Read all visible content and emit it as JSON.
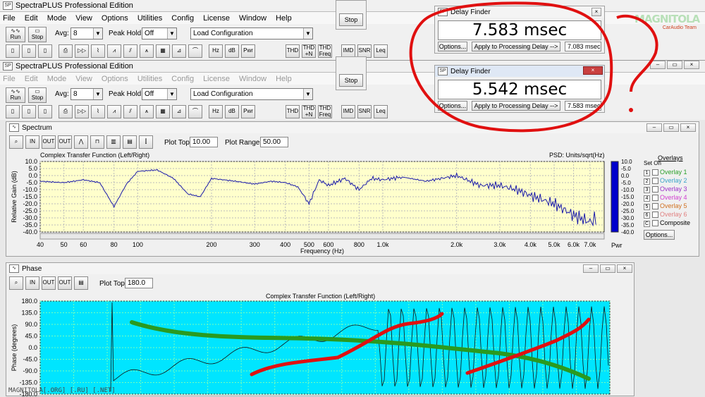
{
  "app": {
    "title": "SpectraPLUS Professional Edition",
    "menu": [
      "File",
      "Edit",
      "Mode",
      "View",
      "Options",
      "Utilities",
      "Config",
      "License",
      "Window",
      "Help"
    ],
    "toolbar": {
      "run_label": "Run",
      "stop_label": "Stop",
      "avg_label": "Avg:",
      "avg_value": "8",
      "peak_label": "Peak Hold:",
      "peak_value": "Off",
      "config_value": "Load Configuration",
      "icons": [
        "Hz",
        "dB",
        "Pwr",
        "THD",
        "THD +N",
        "THD Freq",
        "IMD",
        "SNR",
        "Leq"
      ]
    }
  },
  "stop_dialog": {
    "label": "Stop"
  },
  "delay_finder_1": {
    "title": "Delay Finder",
    "value": "7.583 msec",
    "options_label": "Options...",
    "apply_label": "Apply to Processing Delay -->",
    "result": "7.083 msec"
  },
  "delay_finder_2": {
    "title": "Delay Finder",
    "value": "5.542 msec",
    "options_label": "Options...",
    "apply_label": "Apply to Processing Delay -->",
    "result": "7.583 msec"
  },
  "spectrum": {
    "title": "Spectrum",
    "plot_top_label": "Plot Top:",
    "plot_top_value": "10.00",
    "plot_range_label": "Plot Range:",
    "plot_range_value": "50.00",
    "chart_title": "Complex Transfer Function (Left/Right)",
    "psd_label": "PSD: Units/sqrt(Hz)",
    "ylabel": "Relative Gain (dB)",
    "xlabel": "Frequency (Hz)",
    "y_ticks": [
      "10.0",
      "5.0",
      "0.0",
      "-5.0",
      "-10.0",
      "-15.0",
      "-20.0",
      "-25.0",
      "-30.0",
      "-35.0",
      "-40.0"
    ],
    "x_ticks": [
      "40",
      "50",
      "60",
      "80",
      "100",
      "200",
      "300",
      "400",
      "500",
      "600",
      "800",
      "1.0k",
      "2.0k",
      "3.0k",
      "4.0k",
      "5.0k",
      "6.0k",
      "7.0k"
    ],
    "bar_ticks": [
      "10.0",
      "-5.0",
      "0.0",
      "-5.0",
      "-10.0",
      "-15.0",
      "-20.0",
      "-25.0",
      "-30.0",
      "-35.0",
      "-40.0"
    ],
    "bar_label": "Pwr",
    "overlays_title": "Overlays",
    "overlay_headers": [
      "Set",
      "On"
    ],
    "overlays": [
      {
        "num": "1",
        "label": "Overlay 1",
        "color": "#2aa02a"
      },
      {
        "num": "2",
        "label": "Overlay 2",
        "color": "#3aa3c8"
      },
      {
        "num": "3",
        "label": "Overlay 3",
        "color": "#9b30c8"
      },
      {
        "num": "4",
        "label": "Overlay 4",
        "color": "#d040d0"
      },
      {
        "num": "5",
        "label": "Overlay 5",
        "color": "#d07020"
      },
      {
        "num": "6",
        "label": "Overlay 6",
        "color": "#e08080"
      },
      {
        "num": "C",
        "label": "Composite",
        "color": "#000000"
      }
    ],
    "options_label": "Options..."
  },
  "phase": {
    "title": "Phase",
    "plot_top_label": "Plot Top:",
    "plot_top_value": "180.0",
    "chart_title": "Complex Transfer Function (Left/Right)",
    "ylabel": "Phase (degrees)",
    "y_ticks": [
      "180.0",
      "135.0",
      "90.0",
      "45.0",
      "0.0",
      "-45.0",
      "-90.0",
      "-135.0",
      "-180.0"
    ]
  },
  "watermark": "MAGNITOLA[.ORG] [.RU] [.NET]",
  "logo_text": "MAGNITOLA",
  "logo_sub": "CarAudio Team",
  "colors": {
    "plot_bg": "#ffffcc",
    "phase_bg": "#00e5ff",
    "curve": "#1a1aaa",
    "annotation": "#e01010",
    "green": "#2a9a20"
  },
  "chart_data": [
    {
      "type": "line",
      "title": "Complex Transfer Function (Left/Right)",
      "xlabel": "Frequency (Hz)",
      "ylabel": "Relative Gain (dB)",
      "xscale": "log",
      "xlim": [
        40,
        8000
      ],
      "ylim": [
        -40,
        10
      ],
      "x": [
        40,
        50,
        60,
        70,
        80,
        90,
        100,
        120,
        140,
        160,
        180,
        200,
        250,
        300,
        350,
        400,
        450,
        500,
        550,
        600,
        700,
        800,
        900,
        1000,
        1200,
        1500,
        2000,
        2500,
        3000,
        3500,
        4000,
        5000,
        6000,
        7000,
        7500
      ],
      "values": [
        -4,
        -5,
        -3,
        -5,
        -22,
        -6,
        3,
        4,
        -2,
        -13,
        -15,
        -2,
        -4,
        -6,
        -4,
        -5,
        -8,
        -20,
        -3,
        -7,
        -2,
        -10,
        -2,
        -3,
        -1,
        -4,
        0,
        -7,
        -7,
        -10,
        -14,
        -20,
        -28,
        -33,
        -30
      ]
    },
    {
      "type": "line",
      "title": "Complex Transfer Function (Left/Right)",
      "ylabel": "Phase (degrees)",
      "ylim": [
        -180,
        180
      ]
    }
  ]
}
